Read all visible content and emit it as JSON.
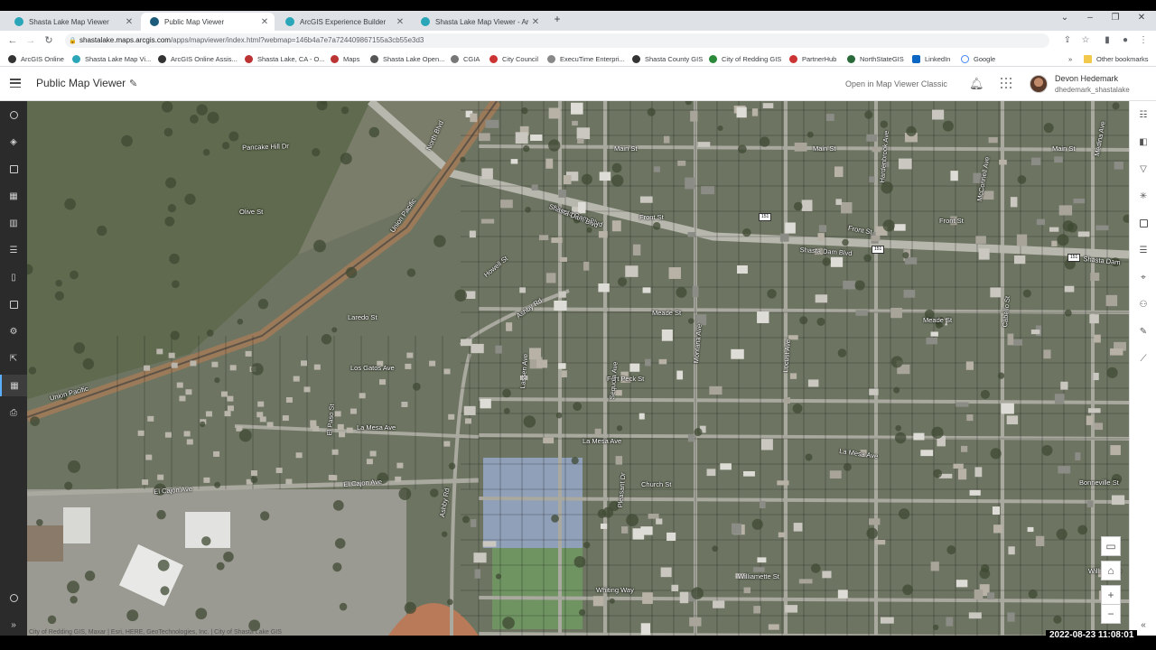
{
  "browser": {
    "tabs": [
      {
        "title": "Shasta Lake Map Viewer",
        "active": false
      },
      {
        "title": "Public Map Viewer",
        "active": true
      },
      {
        "title": "ArcGIS Experience Builder",
        "active": false
      },
      {
        "title": "Shasta Lake Map Viewer - ArcGIS",
        "active": false
      }
    ],
    "url_host": "shastalake.maps.arcgis.com",
    "url_path": "/apps/mapviewer/index.html?webmap=146b4a7e7a724409867155a3cb55e3d3",
    "bookmarks": [
      "ArcGIS Online",
      "Shasta Lake Map Vi...",
      "ArcGIS Online Assis...",
      "Shasta Lake, CA - O...",
      "Maps",
      "Shasta Lake Open...",
      "CGIA",
      "City Council",
      "ExecuTime Enterpri...",
      "Shasta County GIS",
      "City of Redding GIS",
      "PartnerHub",
      "NorthStateGIS",
      "LinkedIn",
      "Google"
    ],
    "other_bookmarks": "Other bookmarks",
    "bookmarks_overflow": "»"
  },
  "app": {
    "title": "Public Map Viewer",
    "classic_link": "Open in Map Viewer Classic",
    "user_name": "Devon Hedemark",
    "user_handle": "dhedemark_shastalake"
  },
  "map": {
    "labels": [
      {
        "text": "Pancake Hill Dr"
      },
      {
        "text": "North Blvd"
      },
      {
        "text": "Olive St"
      },
      {
        "text": "Union Pacific"
      },
      {
        "text": "Union Pacific"
      },
      {
        "text": "Main St"
      },
      {
        "text": "Main St"
      },
      {
        "text": "Main St"
      },
      {
        "text": "Shasta Dam Blvd"
      },
      {
        "text": "Front St"
      },
      {
        "text": "Front St"
      },
      {
        "text": "Front St"
      },
      {
        "text": "Shasta Dam Blvd"
      },
      {
        "text": "Shasta Dam"
      },
      {
        "text": "Laredo St"
      },
      {
        "text": "Ashby Rd"
      },
      {
        "text": "Meade St"
      },
      {
        "text": "Meade St"
      },
      {
        "text": "Los Gatos Ave"
      },
      {
        "text": "Fort Peck St"
      },
      {
        "text": "La Mesa Ave"
      },
      {
        "text": "La Mesa Ave"
      },
      {
        "text": "La Mesa Ave"
      },
      {
        "text": "El Cajon Ave"
      },
      {
        "text": "El Cajon Ave"
      },
      {
        "text": "Church St"
      },
      {
        "text": "Bonneville St"
      },
      {
        "text": "Williamette St"
      },
      {
        "text": "Williamette"
      },
      {
        "text": "Whiting Way"
      },
      {
        "text": "Montana Ave"
      },
      {
        "text": "Locust Ave"
      },
      {
        "text": "Hardenbrook Ave"
      },
      {
        "text": "Cabello St"
      },
      {
        "text": "Lassen Ave"
      },
      {
        "text": "Sequoia Ave"
      },
      {
        "text": "Pleasant Dr"
      },
      {
        "text": "Ashby Rd"
      },
      {
        "text": "El Paso St"
      },
      {
        "text": "Howell St"
      },
      {
        "text": "McConnell Ave"
      },
      {
        "text": "Medina Ave"
      },
      {
        "text": "Shasta Dam Blvd"
      }
    ],
    "shields": [
      "151",
      "151",
      "151"
    ],
    "attribution": "City of Redding GIS, Maxar | Esri, HERE, GeoTechnologies, Inc. | City of Shasta Lake GIS"
  },
  "timestamp": "2022-08-23  11:08:01",
  "colors": {
    "accent": "#5ab0ff",
    "sidebar_bg": "#2b2b2b"
  }
}
